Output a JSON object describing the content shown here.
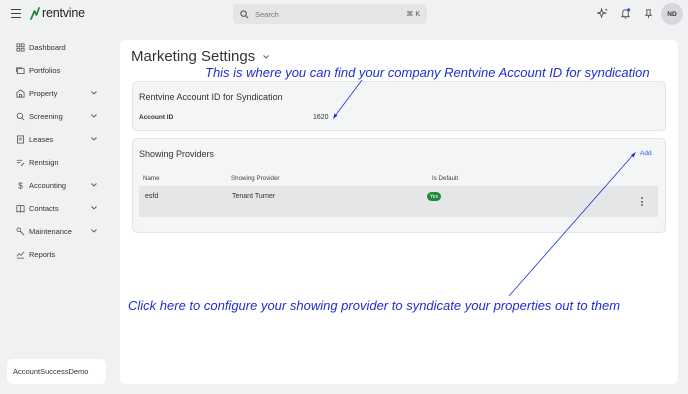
{
  "app": {
    "logo_text": "rentvine",
    "brand_color": "#1f8a3c"
  },
  "search": {
    "placeholder": "Search",
    "shortcut": "⌘ K"
  },
  "header_icons": [
    "sparkle-icon",
    "bell-icon",
    "pin-icon"
  ],
  "user": {
    "initials": "ND"
  },
  "sidebar": {
    "items": [
      {
        "label": "Dashboard",
        "icon": "dashboard-icon",
        "expandable": false
      },
      {
        "label": "Portfolios",
        "icon": "portfolios-icon",
        "expandable": false
      },
      {
        "label": "Property",
        "icon": "property-icon",
        "expandable": true
      },
      {
        "label": "Screening",
        "icon": "screening-icon",
        "expandable": true
      },
      {
        "label": "Leases",
        "icon": "leases-icon",
        "expandable": true
      },
      {
        "label": "Rentsign",
        "icon": "rentsign-icon",
        "expandable": false
      },
      {
        "label": "Accounting",
        "icon": "dollar-icon",
        "expandable": true
      },
      {
        "label": "Contacts",
        "icon": "contacts-icon",
        "expandable": true
      },
      {
        "label": "Maintenance",
        "icon": "wrench-icon",
        "expandable": true
      },
      {
        "label": "Reports",
        "icon": "reports-icon",
        "expandable": false
      }
    ],
    "account_name": "AccountSuccessDemo"
  },
  "main": {
    "title": "Marketing Settings",
    "account_card": {
      "title": "Rentvine Account ID for Syndication",
      "label": "Account ID",
      "value": "1620"
    },
    "providers_card": {
      "title": "Showing Providers",
      "add_label": "Add",
      "columns": [
        "Name",
        "Showing Provider",
        "Is Default"
      ],
      "rows": [
        {
          "name": "esfd",
          "provider": "Tenant Turner",
          "is_default": "Yes"
        }
      ]
    }
  },
  "annotations": {
    "top": "This is where you can find your company Rentvine Account ID for syndication",
    "bottom": "Click here to configure your showing provider to syndicate your properties out to them",
    "color": "#1f2fd0"
  }
}
